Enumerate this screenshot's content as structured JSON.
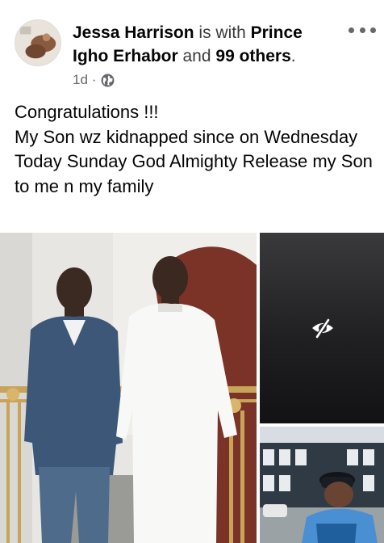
{
  "post": {
    "author": "Jessa Harrison",
    "with_text": " is with ",
    "tagged": "Prince Igho Erhabor",
    "and_text": " and ",
    "others": "99 others",
    "period": ".",
    "time": "1d",
    "separator": "·",
    "audience_icon": "globe-icon",
    "body": "Congratulations !!!\nMy Son wz kidnapped since on Wednesday\nToday Sunday  God Almighty  Release my Son to me n my family"
  },
  "photos": {
    "hidden_icon": "eye-slash-icon"
  },
  "colors": {
    "text": "#050505",
    "secondary": "#65676b"
  }
}
